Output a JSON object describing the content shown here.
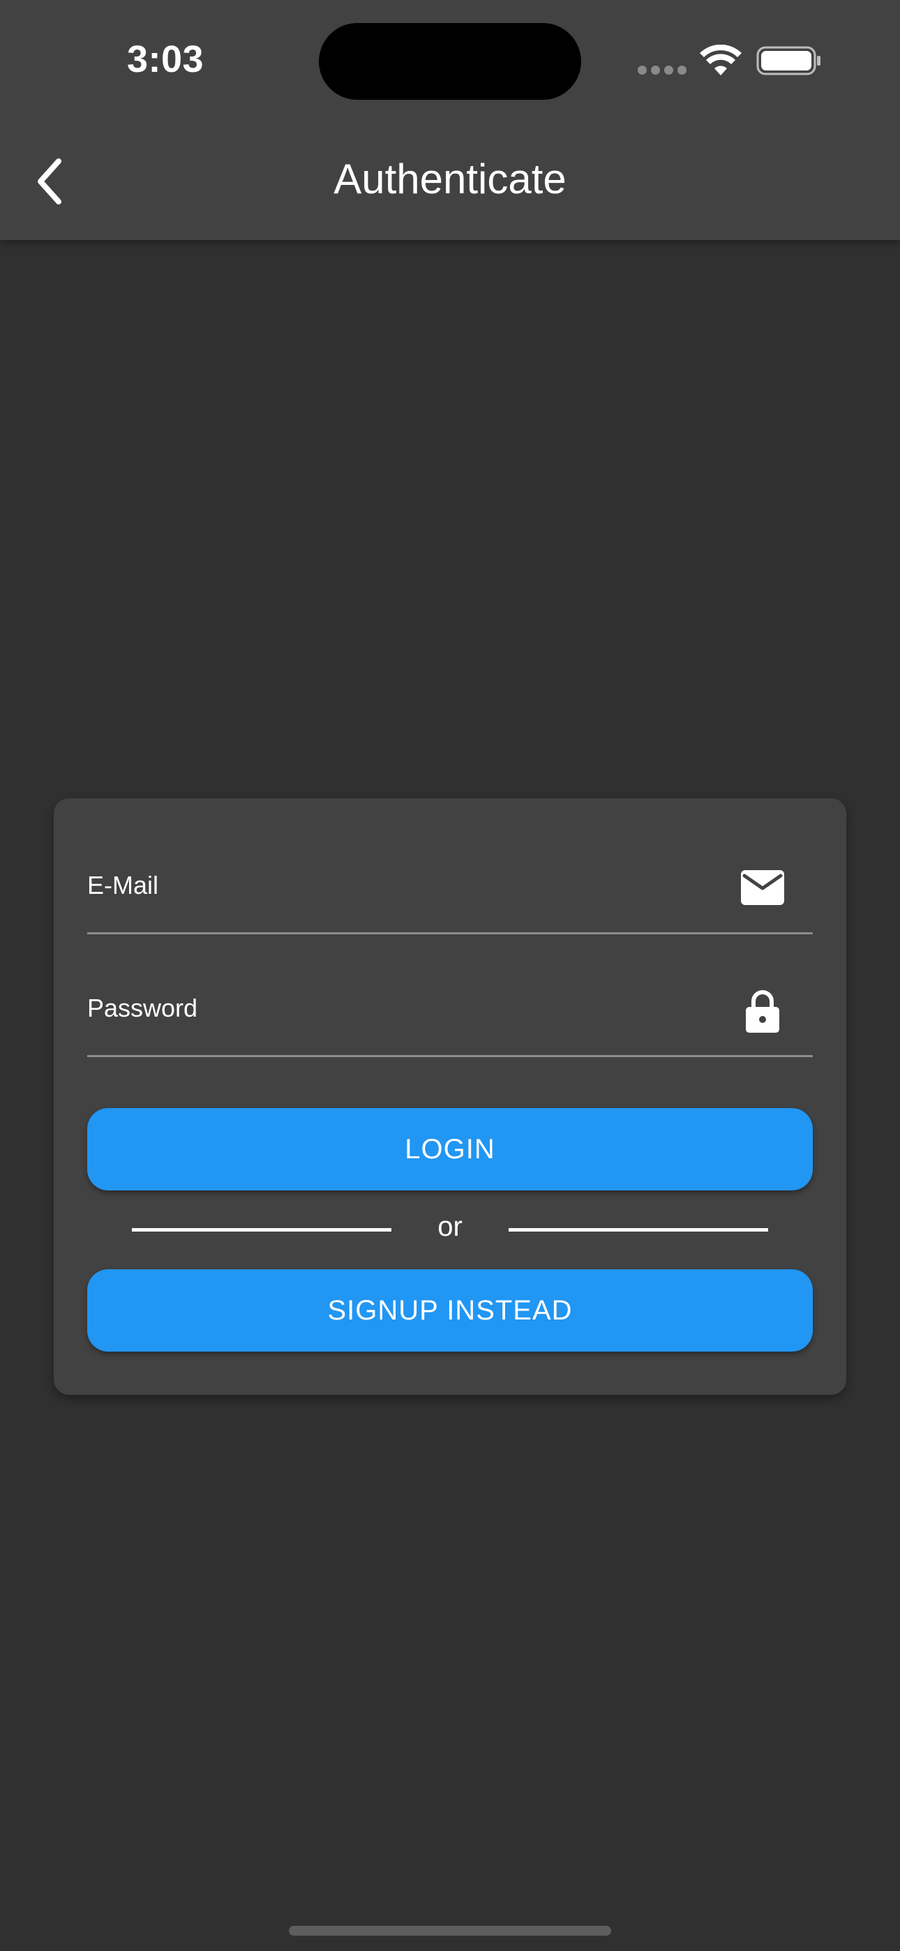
{
  "status_bar": {
    "time": "3:03",
    "icons": [
      "cellular-signal-icon",
      "wifi-icon",
      "battery-icon"
    ]
  },
  "app_bar": {
    "title": "Authenticate",
    "back_icon": "chevron-left-icon"
  },
  "auth_form": {
    "email": {
      "label": "E-Mail",
      "value": "",
      "icon": "envelope-icon"
    },
    "password": {
      "label": "Password",
      "value": "",
      "icon": "lock-icon"
    },
    "login_label": "LOGIN",
    "divider_text": "or",
    "signup_label": "SIGNUP INSTEAD"
  },
  "colors": {
    "background": "#303030",
    "surface": "#424242",
    "accent": "#2196f3",
    "text": "#ffffff",
    "field_underline": "#8c8c8c"
  }
}
